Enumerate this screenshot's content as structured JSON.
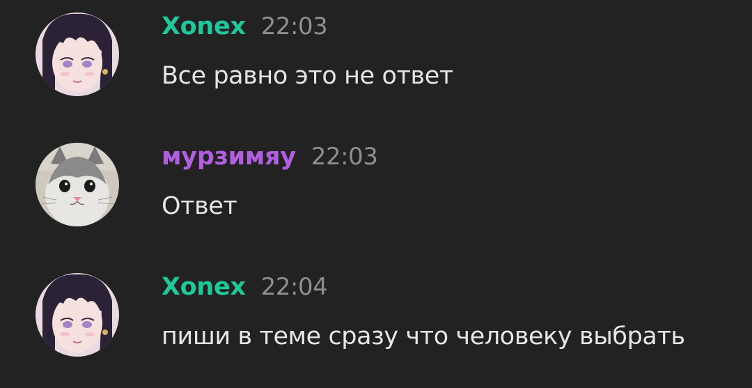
{
  "messages": [
    {
      "author": "Xonex",
      "author_color": "#1fc79a",
      "time": "22:03",
      "text": "Все равно это не ответ",
      "avatar": "anime-girl-avatar"
    },
    {
      "author": "мурзимяу",
      "author_color": "#b15ee0",
      "time": "22:03",
      "text": "Ответ",
      "avatar": "cat-avatar"
    },
    {
      "author": "Xonex",
      "author_color": "#1fc79a",
      "time": "22:04",
      "text": "пиши в теме сразу что человеку выбрать",
      "avatar": "anime-girl-avatar"
    }
  ]
}
